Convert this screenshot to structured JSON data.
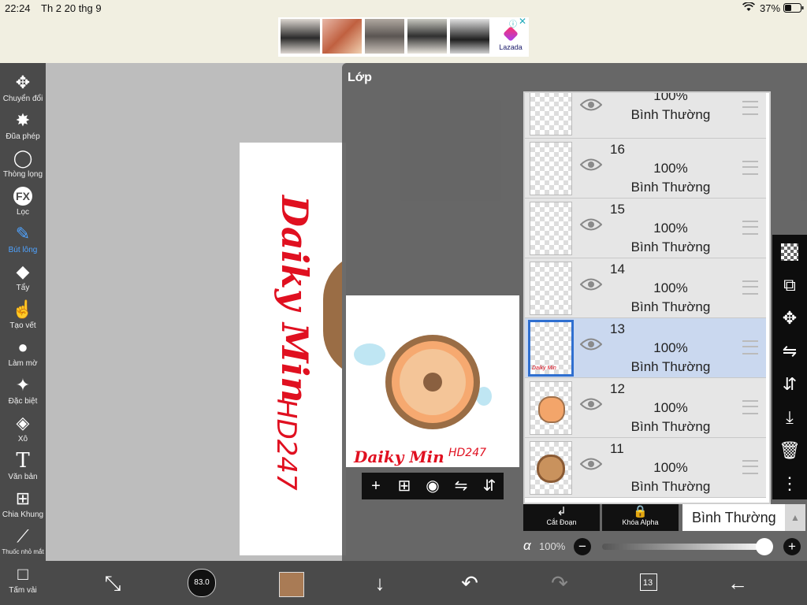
{
  "status": {
    "time": "22:24",
    "date": "Th 2 20 thg 9",
    "battery": "37%"
  },
  "ad": {
    "brand": "Lazada"
  },
  "toolbar": {
    "tools": [
      {
        "label": "Chuyển đổi",
        "icon": "move-icon"
      },
      {
        "label": "Đũa phép",
        "icon": "magic-wand-icon"
      },
      {
        "label": "Thòng lọng",
        "icon": "lasso-icon"
      },
      {
        "label": "Lọc",
        "icon": "fx-icon"
      },
      {
        "label": "Bút lông",
        "icon": "brush-icon",
        "active": true
      },
      {
        "label": "Tẩy",
        "icon": "eraser-icon"
      },
      {
        "label": "Tạo vết",
        "icon": "smudge-icon"
      },
      {
        "label": "Làm mờ",
        "icon": "blur-icon"
      },
      {
        "label": "Đặc biệt",
        "icon": "special-icon"
      },
      {
        "label": "Xô",
        "icon": "bucket-icon"
      },
      {
        "label": "Văn bản",
        "icon": "text-icon"
      },
      {
        "label": "Chia Khung",
        "icon": "frame-divider-icon"
      },
      {
        "label": "Thuốc nhỏ mắt",
        "icon": "eyedropper-icon"
      },
      {
        "label": "Tấm vải",
        "icon": "canvas-icon"
      }
    ]
  },
  "bottombar": {
    "brush_size": "83.0",
    "layer_count": "13",
    "color": "#a97b55"
  },
  "layers_panel": {
    "title": "Lớp",
    "layers": [
      {
        "number": "",
        "opacity": "100%",
        "mode": "Bình Thường"
      },
      {
        "number": "16",
        "opacity": "100%",
        "mode": "Bình Thường"
      },
      {
        "number": "15",
        "opacity": "100%",
        "mode": "Bình Thường"
      },
      {
        "number": "14",
        "opacity": "100%",
        "mode": "Bình Thường"
      },
      {
        "number": "13",
        "opacity": "100%",
        "mode": "Bình Thường",
        "selected": true
      },
      {
        "number": "12",
        "opacity": "100%",
        "mode": "Bình Thường"
      },
      {
        "number": "11",
        "opacity": "100%",
        "mode": "Bình Thường"
      }
    ],
    "clip_label": "Cắt Đoạn",
    "alpha_lock_label": "Khóa Alpha",
    "blend_mode": "Bình Thường",
    "alpha_symbol": "α",
    "alpha_value": "100%"
  },
  "artwork": {
    "signature": "Daiky Min",
    "signature_code": "HD247"
  }
}
